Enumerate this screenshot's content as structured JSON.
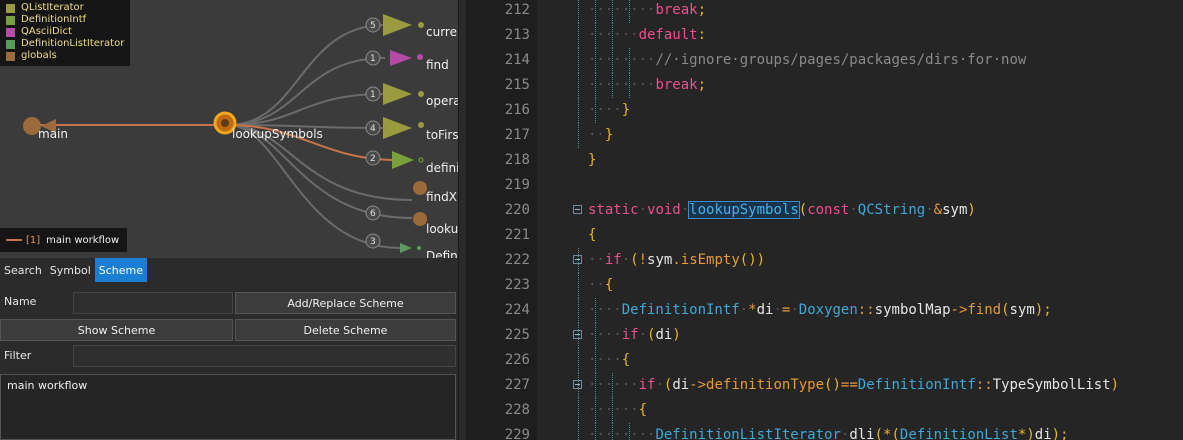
{
  "graph": {
    "legend": [
      {
        "label": "QListIterator",
        "color": "#9a9a3e"
      },
      {
        "label": "DefinitionIntf",
        "color": "#7aa03e"
      },
      {
        "label": "QAsciiDict",
        "color": "#b64aa8"
      },
      {
        "label": "DefinitionListIterator",
        "color": "#5a9a5a"
      },
      {
        "label": "globals",
        "color": "#9a6a3a"
      }
    ],
    "scheme_tag": {
      "number": "[1]",
      "label": "main workflow"
    },
    "nodes": {
      "main": "main",
      "center": "lookupSymbols",
      "current": "curren",
      "find": "find",
      "operator": "opera",
      "toFirst": "toFirs",
      "definition": "defini",
      "findXRef": "findXI",
      "lookup": "looku",
      "definitionList": "Defin"
    },
    "badges": [
      "5",
      "1",
      "1",
      "4",
      "2",
      "6",
      "3"
    ]
  },
  "panel": {
    "tabs": [
      "Search",
      "Symbol",
      "Scheme"
    ],
    "name_label": "Name",
    "add_replace": "Add/Replace Scheme",
    "show_scheme": "Show Scheme",
    "delete_scheme": "Delete Scheme",
    "filter_label": "Filter",
    "name_value": "",
    "filter_value": "",
    "schemes": [
      "main workflow"
    ]
  },
  "editor": {
    "lines": [
      {
        "n": "212",
        "indent": 8,
        "tokens": [
          [
            "break",
            "kw"
          ],
          [
            ";",
            "pn"
          ]
        ]
      },
      {
        "n": "213",
        "indent": 6,
        "tokens": [
          [
            "default",
            "kw"
          ],
          [
            ":",
            "pn"
          ]
        ]
      },
      {
        "n": "214",
        "indent": 8,
        "tokens": [
          [
            "//·ignore·groups/pages/packages/dirs·for·now",
            "cm"
          ]
        ]
      },
      {
        "n": "215",
        "indent": 8,
        "tokens": [
          [
            "break",
            "kw"
          ],
          [
            ";",
            "pn"
          ]
        ]
      },
      {
        "n": "216",
        "indent": 4,
        "tokens": [
          [
            "}",
            "pn"
          ]
        ]
      },
      {
        "n": "217",
        "indent": 2,
        "tokens": [
          [
            "}",
            "pn"
          ]
        ]
      },
      {
        "n": "218",
        "indent": 0,
        "tokens": [
          [
            "}",
            "pn"
          ]
        ]
      },
      {
        "n": "219",
        "indent": 0,
        "tokens": []
      },
      {
        "n": "220",
        "indent": 0,
        "fold": true,
        "tokens": [
          [
            "static",
            "kw"
          ],
          [
            "·",
            "ws"
          ],
          [
            "void",
            "kw"
          ],
          [
            "·",
            "ws"
          ],
          [
            "lookupSymbols",
            "hl"
          ],
          [
            "(",
            "pn"
          ],
          [
            "const",
            "kw"
          ],
          [
            "·",
            "ws"
          ],
          [
            "QCString",
            "ty"
          ],
          [
            "·",
            "ws"
          ],
          [
            "&",
            "op"
          ],
          [
            "sym",
            "id"
          ],
          [
            ")",
            "pn"
          ]
        ]
      },
      {
        "n": "221",
        "indent": 0,
        "tokens": [
          [
            "{",
            "pn"
          ]
        ]
      },
      {
        "n": "222",
        "indent": 2,
        "fold": true,
        "tokens": [
          [
            "if",
            "kw"
          ],
          [
            "·",
            "ws"
          ],
          [
            "(",
            "pn"
          ],
          [
            "!",
            "op"
          ],
          [
            "sym",
            "id"
          ],
          [
            ".",
            "op"
          ],
          [
            "isEmpty",
            "fn"
          ],
          [
            "())",
            "pn"
          ]
        ]
      },
      {
        "n": "223",
        "indent": 2,
        "tokens": [
          [
            "{",
            "pn"
          ]
        ]
      },
      {
        "n": "224",
        "indent": 4,
        "tokens": [
          [
            "DefinitionIntf",
            "ty"
          ],
          [
            "·",
            "ws"
          ],
          [
            "*",
            "op"
          ],
          [
            "di",
            "id"
          ],
          [
            "·",
            "ws"
          ],
          [
            "=",
            "op"
          ],
          [
            "·",
            "ws"
          ],
          [
            "Doxygen",
            "ty"
          ],
          [
            "::",
            "op"
          ],
          [
            "symbolMap",
            "id"
          ],
          [
            "->",
            "op"
          ],
          [
            "find",
            "fn"
          ],
          [
            "(",
            "pn"
          ],
          [
            "sym",
            "id"
          ],
          [
            ");",
            "pn"
          ]
        ]
      },
      {
        "n": "225",
        "indent": 4,
        "fold": true,
        "tokens": [
          [
            "if",
            "kw"
          ],
          [
            "·",
            "ws"
          ],
          [
            "(",
            "pn"
          ],
          [
            "di",
            "id"
          ],
          [
            ")",
            "pn"
          ]
        ]
      },
      {
        "n": "226",
        "indent": 4,
        "tokens": [
          [
            "{",
            "pn"
          ]
        ]
      },
      {
        "n": "227",
        "indent": 6,
        "fold": true,
        "tokens": [
          [
            "if",
            "kw"
          ],
          [
            "·",
            "ws"
          ],
          [
            "(",
            "pn"
          ],
          [
            "di",
            "id"
          ],
          [
            "->",
            "op"
          ],
          [
            "definitionType",
            "fn"
          ],
          [
            "()",
            "pn"
          ],
          [
            "==",
            "op"
          ],
          [
            "DefinitionIntf",
            "ty"
          ],
          [
            "::",
            "op"
          ],
          [
            "TypeSymbolList",
            "id"
          ],
          [
            ")",
            "pn"
          ]
        ]
      },
      {
        "n": "228",
        "indent": 6,
        "tokens": [
          [
            "{",
            "pn"
          ]
        ]
      },
      {
        "n": "229",
        "indent": 8,
        "tokens": [
          [
            "DefinitionListIterator",
            "ty"
          ],
          [
            "·",
            "ws"
          ],
          [
            "dli",
            "id"
          ],
          [
            "(*(",
            "pn"
          ],
          [
            "DefinitionList",
            "ty"
          ],
          [
            "*)",
            "pn"
          ],
          [
            "di",
            "id"
          ],
          [
            ");",
            "pn"
          ]
        ]
      }
    ]
  }
}
